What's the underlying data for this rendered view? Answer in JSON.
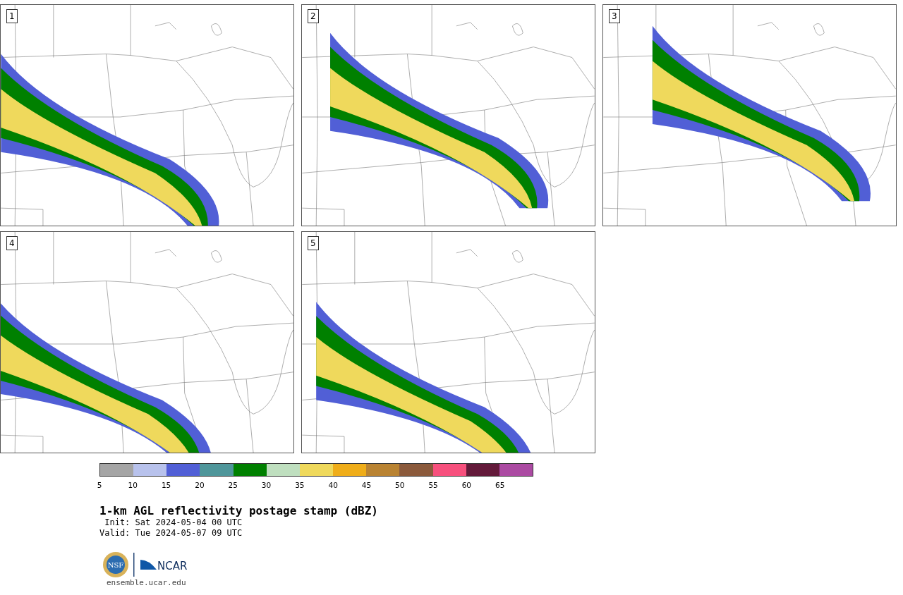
{
  "panels": [
    {
      "label": "1"
    },
    {
      "label": "2"
    },
    {
      "label": "3"
    },
    {
      "label": "4"
    },
    {
      "label": "5"
    }
  ],
  "colorbar": {
    "bins": [
      {
        "color": "#a5a5a5"
      },
      {
        "color": "#b8c2ec"
      },
      {
        "color": "#515fd6"
      },
      {
        "color": "#4f969a"
      },
      {
        "color": "#008000"
      },
      {
        "color": "#bfdfbf"
      },
      {
        "color": "#efd95c"
      },
      {
        "color": "#efad19"
      },
      {
        "color": "#b98332"
      },
      {
        "color": "#8b5a3c"
      },
      {
        "color": "#f7507d"
      },
      {
        "color": "#631a3a"
      },
      {
        "color": "#ab4aa2"
      }
    ],
    "ticks": [
      "5",
      "10",
      "15",
      "20",
      "25",
      "30",
      "35",
      "40",
      "45",
      "50",
      "55",
      "60",
      "65"
    ]
  },
  "title": "1-km AGL reflectivity postage stamp (dBZ)",
  "init": " Init: Sat 2024-05-04 00 UTC",
  "valid": "Valid: Tue 2024-05-07 09 UTC",
  "logos": {
    "nsf_text": "NSF",
    "ncar_text": "NCAR"
  },
  "footer": "ensemble.ucar.edu"
}
